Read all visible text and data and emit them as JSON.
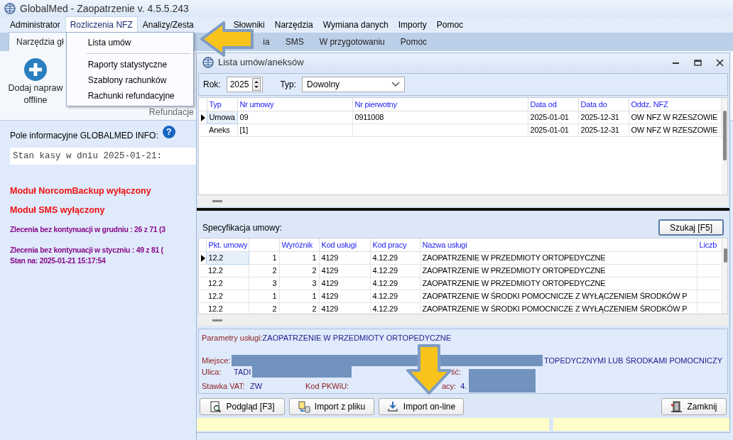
{
  "window": {
    "title": "GlobalMed - Zaopatrzenie v. 4.5.5.243"
  },
  "menu": [
    {
      "label": "Administrator",
      "selected": false
    },
    {
      "label": "Rozliczenia NFZ",
      "selected": true
    },
    {
      "label": "Analizy/Zesta",
      "selected": false
    },
    {
      "label": "Słowniki",
      "selected": false
    },
    {
      "label": "Narzędzia",
      "selected": false
    },
    {
      "label": "Wymiana danych",
      "selected": false
    },
    {
      "label": "Importy",
      "selected": false
    },
    {
      "label": "Pomoc",
      "selected": false
    }
  ],
  "dropdown": [
    {
      "kind": "item",
      "label": "Lista umów"
    },
    {
      "kind": "separator"
    },
    {
      "kind": "item",
      "label": "Raporty statystyczne"
    },
    {
      "kind": "item",
      "label": "Szablony rachunków"
    },
    {
      "kind": "item",
      "label": "Rachunki refundacyjne"
    }
  ],
  "tabs": [
    {
      "label": "Narzędzia gł",
      "selected": true
    },
    {
      "label": "ia",
      "selected": false
    },
    {
      "label": "SMS",
      "selected": false
    },
    {
      "label": "W przygotowaniu",
      "selected": false
    },
    {
      "label": "Pomoc",
      "selected": false
    }
  ],
  "ribbon": {
    "button_lines": [
      "Dodaj napraw",
      "offline"
    ],
    "group": "Refundacje"
  },
  "info": {
    "label": "Pole informacyjne GLOBALMED INFO:",
    "help": "?",
    "field_value": "Stan kasy w dniu 2025-01-21:",
    "messages": [
      {
        "kind": "alert",
        "text": "Moduł NorcomBackup wyłączony"
      },
      {
        "kind": "alert",
        "text": "Moduł SMS wyłączony"
      },
      {
        "kind": "stat",
        "text": "Zlecenia bez kontynuacji w grudniu : 26 z 71 (3"
      },
      {
        "kind": "stat",
        "text": "Zlecenia bez kontynuacji w styczniu : 49 z 81 ("
      },
      {
        "kind": "stat",
        "text": "Stan na: 2025-01-21 15:17:54"
      }
    ]
  },
  "dialog": {
    "title": "Lista umów/aneksów",
    "year_label": "Rok:",
    "year": "2025",
    "type_label": "Typ:",
    "type_value": "Dowolny",
    "contracts": {
      "columns": [
        "Typ",
        "Nr umowy",
        "Nr pierwotny",
        "Data od",
        "Data do",
        "Oddz. NFZ"
      ],
      "rows": [
        {
          "selected": true,
          "cells": [
            "Umowa",
            "09",
            "0911008",
            "2025-01-01",
            "2025-12-31",
            "OW NFZ W RZESZOWIE"
          ]
        },
        {
          "selected": false,
          "cells": [
            "Aneks",
            "[1]",
            null,
            "2025-01-01",
            "2025-12-31",
            "OW NFZ W RZESZOWIE"
          ]
        }
      ]
    },
    "spec_label": "Specyfikacja umowy:",
    "search_button": "Szukaj [F5]",
    "items": {
      "columns": [
        "Pkt. umowy",
        null,
        "Wyróżnik",
        "Kod usługi",
        "Kod pracy",
        "Nazwa usługi",
        "Liczb"
      ],
      "rows": [
        {
          "selected": true,
          "cells": [
            "12.2",
            "1",
            "1",
            "4129",
            "4.12.29",
            "ZAOPATRZENIE W PRZEDMIOTY ORTOPEDYCZNE"
          ]
        },
        {
          "selected": false,
          "cells": [
            "12.2",
            "2",
            "2",
            "4129",
            "4.12.29",
            "ZAOPATRZENIE W PRZEDMIOTY ORTOPEDYCZNE"
          ]
        },
        {
          "selected": false,
          "cells": [
            "12.2",
            "3",
            "3",
            "4129",
            "4.12.29",
            "ZAOPATRZENIE W PRZEDMIOTY ORTOPEDYCZNE"
          ]
        },
        {
          "selected": false,
          "cells": [
            "12.2",
            "1",
            "1",
            "4129",
            "4.12.29",
            "ZAOPATRZENIE W ŚRODKI POMOCNICZE Z WYŁĄCZENIEM ŚRODKÓW P"
          ]
        },
        {
          "selected": false,
          "cells": [
            "12.2",
            "2",
            "2",
            "4129",
            "4.12.29",
            "ZAOPATRZENIE W ŚRODKI POMOCNICZE Z WYŁĄCZENIEM ŚRODKÓW P"
          ]
        }
      ]
    },
    "params": {
      "service_label": "Parametry usługi:",
      "service_value": "ZAOPATRZENIE W PRZEDMIOTY ORTOPEDYCZNE",
      "place_label": "Miejsce:",
      "place_value": "TOPEDYCZNYMI LUB ŚRODKAMI POMOCNICZY",
      "street_label": "Ulica:",
      "street_value": "TADI",
      "qty_label": "ść:",
      "vat_label": "Stawka VAT:",
      "vat_value": "ZW",
      "pkwiu_label": "Kod PKWiU:",
      "work_label": "acy:",
      "work_value": "4."
    },
    "buttons": [
      {
        "kind": "preview",
        "label": "Podgląd [F3]"
      },
      {
        "kind": "file",
        "label": "Import z pliku"
      },
      {
        "kind": "download",
        "label": "Import on-line"
      },
      {
        "kind": "close",
        "label": "Zamknij"
      }
    ]
  }
}
